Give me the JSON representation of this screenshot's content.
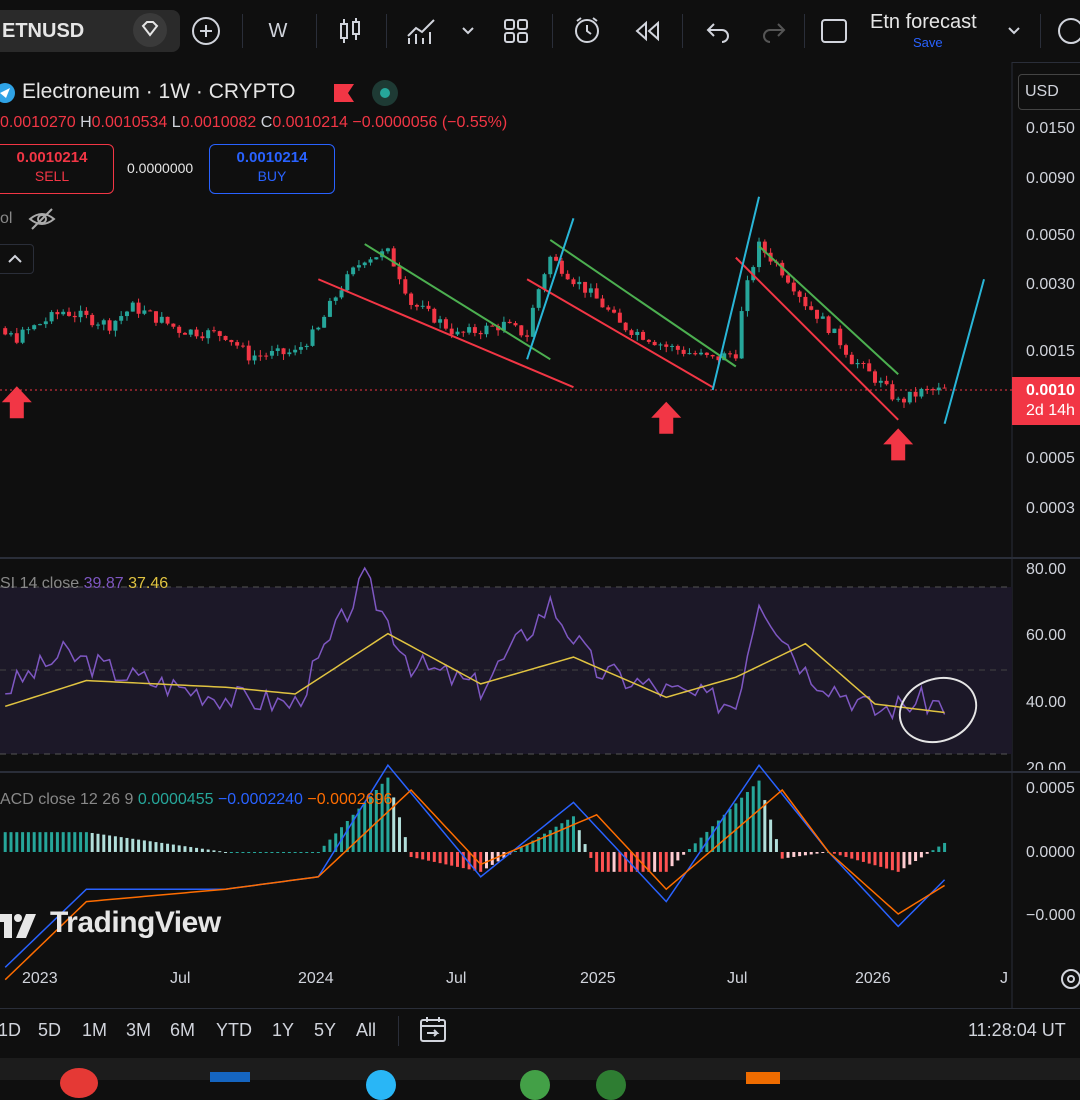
{
  "toolbar": {
    "symbol": "ETNUSD",
    "interval": "W",
    "layout_name": "Etn forecast",
    "save_label": "Save"
  },
  "header": {
    "title": "Electroneum · 1W · CRYPTO",
    "open_key": "O",
    "open": "0.0010270",
    "high_key": "H",
    "high": "0.0010534",
    "low_key": "L",
    "low": "0.0010082",
    "close_key": "C",
    "close": "0.0010214",
    "change": "−0.0000056 (−0.55%)",
    "sell_price": "0.0010214",
    "sell_label": "SELL",
    "spread": "0.0000000",
    "buy_price": "0.0010214",
    "buy_label": "BUY",
    "vol_label": "ol",
    "currency": "USD"
  },
  "price_axis": {
    "ticks": [
      "0.0150",
      "0.0090",
      "0.0050",
      "0.0030",
      "0.0015",
      "0.0005",
      "0.0003"
    ],
    "last_price": "0.0010",
    "countdown": "2d 14h"
  },
  "time_axis": {
    "ticks": [
      "2023",
      "Jul",
      "2024",
      "Jul",
      "2025",
      "Jul",
      "2026",
      "J"
    ]
  },
  "rsi": {
    "label": "SI 14 close",
    "rsi_value": "39.87",
    "ma_value": "37.46",
    "ticks": [
      "80.00",
      "60.00",
      "40.00",
      "20.00"
    ]
  },
  "macd": {
    "label": "ACD close 12 26 9",
    "hist_value": "0.0000455",
    "macd_value": "−0.0002240",
    "signal_value": "−0.0002696",
    "ticks": [
      "0.0005",
      "0.0000",
      "−0.000"
    ]
  },
  "watermark": "TradingView",
  "bottom": {
    "ranges": [
      "1D",
      "5D",
      "1M",
      "3M",
      "6M",
      "YTD",
      "1Y",
      "5Y",
      "All"
    ],
    "clock": "11:28:04 UT"
  },
  "colors": {
    "up": "#26a69a",
    "down": "#f23645",
    "rsi_line": "#7e57c2",
    "rsi_ma": "#e0c341",
    "macd_line": "#2962ff",
    "signal_line": "#ff6d00",
    "trend_green": "#4caf50",
    "trend_red": "#f23645",
    "trend_cyan": "#29b6d8",
    "arrow": "#f23645"
  },
  "chart_data": [
    {
      "type": "candlestick",
      "title": "Electroneum · 1W · CRYPTO",
      "y_scale": "log",
      "x_range": [
        "2022-10",
        "2026-05"
      ],
      "ylim": [
        0.0003,
        0.015
      ],
      "series": [
        {
          "date": "2022-10",
          "close": 0.00195
        },
        {
          "date": "2022-12",
          "close": 0.00175
        },
        {
          "date": "2023-02",
          "close": 0.0023
        },
        {
          "date": "2023-04",
          "close": 0.002
        },
        {
          "date": "2023-05",
          "close": 0.0024
        },
        {
          "date": "2023-07",
          "close": 0.0019
        },
        {
          "date": "2023-09",
          "close": 0.0018
        },
        {
          "date": "2023-10",
          "close": 0.00145
        },
        {
          "date": "2023-12",
          "close": 0.0015
        },
        {
          "date": "2024-01",
          "close": 0.0019
        },
        {
          "date": "2024-03",
          "close": 0.004
        },
        {
          "date": "2024-04",
          "close": 0.0042
        },
        {
          "date": "2024-05",
          "close": 0.0025
        },
        {
          "date": "2024-07",
          "close": 0.0018
        },
        {
          "date": "2024-09",
          "close": 0.002
        },
        {
          "date": "2024-10",
          "close": 0.0018
        },
        {
          "date": "2024-11",
          "close": 0.004
        },
        {
          "date": "2024-12",
          "close": 0.0032
        },
        {
          "date": "2025-02",
          "close": 0.002
        },
        {
          "date": "2025-04",
          "close": 0.0016
        },
        {
          "date": "2025-06",
          "close": 0.0014
        },
        {
          "date": "2025-07",
          "close": 0.0015
        },
        {
          "date": "2025-08",
          "close": 0.0045
        },
        {
          "date": "2025-10",
          "close": 0.0025
        },
        {
          "date": "2025-12",
          "close": 0.0014
        },
        {
          "date": "2026-02",
          "close": 0.0009
        },
        {
          "date": "2026-03",
          "close": 0.001
        },
        {
          "date": "2026-04",
          "close": 0.00102
        }
      ],
      "annotations": [
        "up arrows marking cycle lows",
        "descending channels",
        "breakout lines"
      ]
    },
    {
      "type": "line",
      "title": "RSI 14 close",
      "ylim": [
        20,
        80
      ],
      "series": [
        {
          "name": "RSI",
          "x": [
            "2022-10",
            "2023-02",
            "2023-05",
            "2023-09",
            "2023-12",
            "2024-03",
            "2024-05",
            "2024-08",
            "2024-11",
            "2025-01",
            "2025-04",
            "2025-07",
            "2025-08",
            "2025-10",
            "2026-01",
            "2026-03",
            "2026-04"
          ],
          "values": [
            38,
            55,
            48,
            42,
            40,
            77,
            52,
            45,
            70,
            50,
            44,
            40,
            72,
            50,
            38,
            41,
            39.87
          ]
        },
        {
          "name": "RSI MA",
          "x": [
            "2022-10",
            "2023-03",
            "2023-09",
            "2023-12",
            "2024-04",
            "2024-08",
            "2024-12",
            "2025-04",
            "2025-07",
            "2025-10",
            "2026-01",
            "2026-04"
          ],
          "values": [
            36,
            47,
            45,
            43,
            61,
            46,
            54,
            42,
            48,
            58,
            40,
            37.46
          ]
        }
      ]
    },
    {
      "type": "bar",
      "title": "MACD close 12 26 9",
      "series": [
        {
          "name": "MACD",
          "x": [
            "2022-10",
            "2023-03",
            "2023-09",
            "2024-01",
            "2024-04",
            "2024-08",
            "2024-12",
            "2025-04",
            "2025-08",
            "2025-11",
            "2026-02",
            "2026-04"
          ],
          "values": [
            -0.0012,
            -0.0003,
            -0.0003,
            -0.0002,
            0.0007,
            -0.0002,
            0.0004,
            -0.0004,
            0.0007,
            0.0,
            -0.0006,
            -0.000224
          ]
        },
        {
          "name": "Signal",
          "x": [
            "2022-10",
            "2023-03",
            "2023-09",
            "2024-01",
            "2024-05",
            "2024-08",
            "2025-01",
            "2025-04",
            "2025-09",
            "2025-11",
            "2026-02",
            "2026-04"
          ],
          "values": [
            -0.0013,
            -0.0004,
            -0.0003,
            -0.0002,
            0.0005,
            -0.0001,
            0.0003,
            -0.0003,
            0.0005,
            0.0,
            -0.0005,
            -0.0002696
          ]
        }
      ]
    }
  ]
}
